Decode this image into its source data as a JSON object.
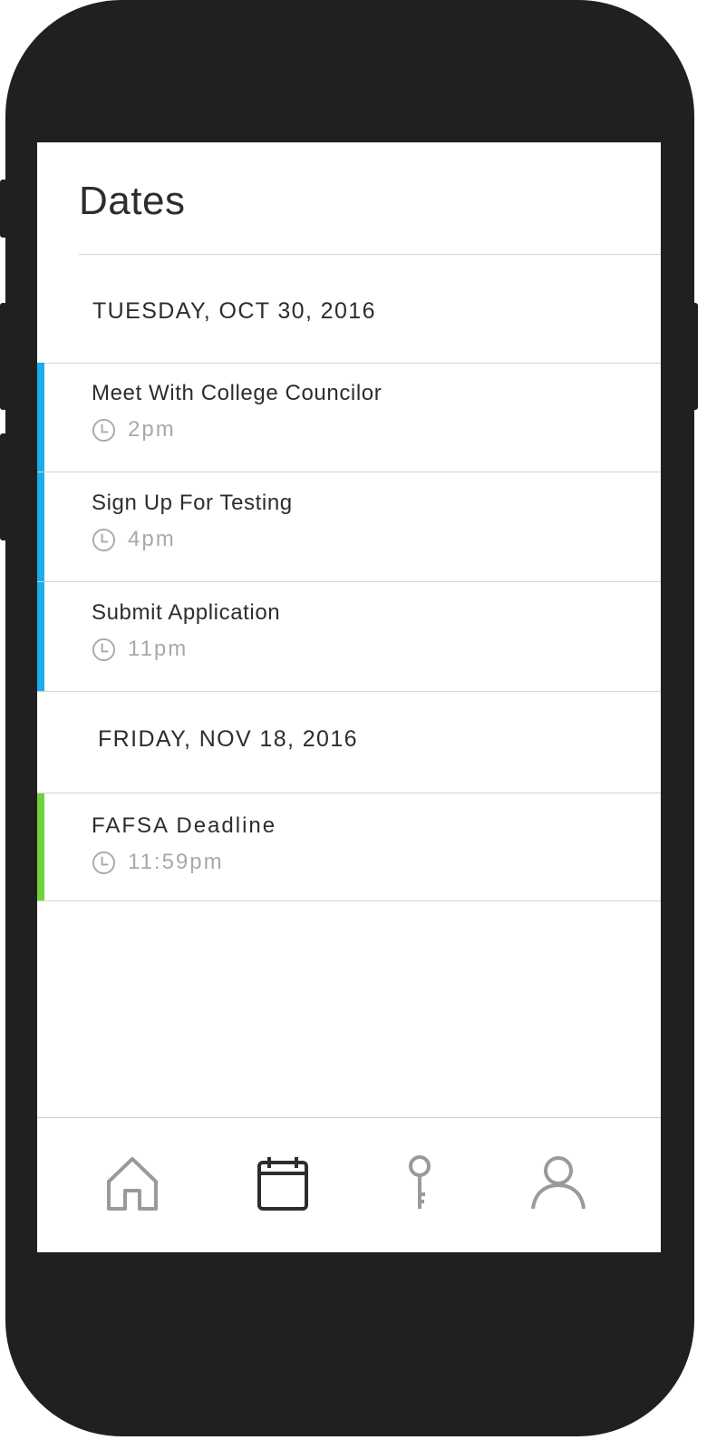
{
  "header": {
    "title": "Dates"
  },
  "sections": [
    {
      "date": "TUESDAY, OCT 30, 2016",
      "events": [
        {
          "title": "Meet With College Councilor",
          "time": "2pm",
          "color": "#1AADEA"
        },
        {
          "title": "Sign Up For Testing",
          "time": "4pm",
          "color": "#1AADEA"
        },
        {
          "title": "Submit Application",
          "time": "11pm",
          "color": "#1AADEA"
        }
      ]
    },
    {
      "date": "FRIDAY, NOV 18, 2016",
      "events": [
        {
          "title": "FAFSA Deadline",
          "time": "11:59pm",
          "color": "#6FD43A"
        }
      ]
    }
  ],
  "tabbar": {
    "tabs": [
      {
        "icon": "home-icon",
        "active": false
      },
      {
        "icon": "calendar-icon",
        "active": true
      },
      {
        "icon": "key-icon",
        "active": false
      },
      {
        "icon": "profile-icon",
        "active": false
      }
    ]
  },
  "colors": {
    "accent_blue": "#1AADEA",
    "accent_green": "#6FD43A",
    "active_icon": "#2D2D2D",
    "inactive_icon": "#9A9A9A"
  }
}
